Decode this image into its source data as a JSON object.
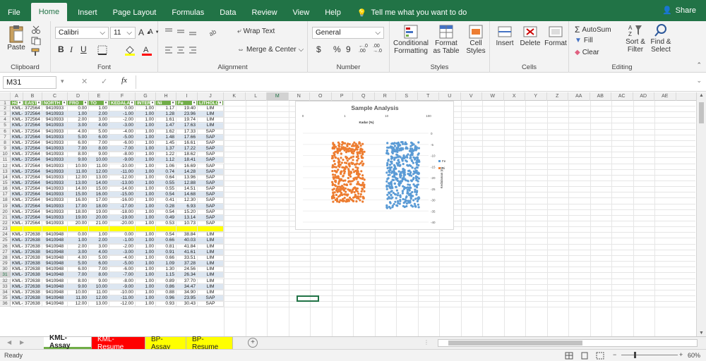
{
  "ribbon_tabs": [
    "File",
    "Home",
    "Insert",
    "Page Layout",
    "Formulas",
    "Data",
    "Review",
    "View",
    "Help"
  ],
  "active_tab": "Home",
  "tell_me": "Tell me what you want to do",
  "share": "Share",
  "ribbon": {
    "clipboard": {
      "label": "Clipboard",
      "paste": "Paste"
    },
    "font": {
      "label": "Font",
      "name": "Calibri",
      "size": "11"
    },
    "alignment": {
      "label": "Alignment",
      "wrap": "Wrap Text",
      "merge": "Merge & Center"
    },
    "number": {
      "label": "Number",
      "format": "General"
    },
    "styles": {
      "label": "Styles",
      "cond": "Conditional Formatting",
      "table": "Format as Table",
      "cell": "Cell Styles"
    },
    "cells": {
      "label": "Cells",
      "insert": "Insert",
      "delete": "Delete",
      "format": "Format"
    },
    "editing": {
      "label": "Editing",
      "autosum": "AutoSum",
      "fill": "Fill",
      "clear": "Clear",
      "sort": "Sort & Filter",
      "find": "Find & Select"
    }
  },
  "name_box": "M31",
  "columns": [
    "A",
    "B",
    "C",
    "D",
    "E",
    "F",
    "G",
    "H",
    "I",
    "J",
    "K",
    "L",
    "M",
    "N",
    "O",
    "P",
    "Q",
    "R",
    "S",
    "T",
    "U",
    "V",
    "W",
    "X",
    "Y",
    "Z",
    "AA",
    "AB",
    "AC",
    "AD",
    "AE"
  ],
  "headers": [
    "HOLE",
    "EASTI",
    "NORTH",
    "FRO",
    "TO",
    "KEDALAN",
    "INTER",
    "Ni",
    "Fe",
    "LITHOLO"
  ],
  "rows": [
    [
      "KML-14",
      "372564",
      "9410933",
      "0.00",
      "1.00",
      "0.00",
      "1.00",
      "1.17",
      "19.40",
      "LIM"
    ],
    [
      "KML-14",
      "372564",
      "9410933",
      "1.00",
      "2.00",
      "-1.00",
      "1.00",
      "1.28",
      "23.96",
      "LIM"
    ],
    [
      "KML-14",
      "372564",
      "9410933",
      "2.00",
      "3.00",
      "-2.00",
      "1.00",
      "1.61",
      "19.74",
      "LIM"
    ],
    [
      "KML-14",
      "372564",
      "9410933",
      "3.00",
      "4.00",
      "-3.00",
      "1.00",
      "1.47",
      "17.63",
      "LIM"
    ],
    [
      "KML-14",
      "372564",
      "9410933",
      "4.00",
      "5.00",
      "-4.00",
      "1.00",
      "1.62",
      "17.33",
      "SAP"
    ],
    [
      "KML-14",
      "372564",
      "9410933",
      "5.00",
      "6.00",
      "-5.00",
      "1.00",
      "1.48",
      "17.66",
      "SAP"
    ],
    [
      "KML-14",
      "372564",
      "9410933",
      "6.00",
      "7.00",
      "-6.00",
      "1.00",
      "1.45",
      "16.61",
      "SAP"
    ],
    [
      "KML-14",
      "372564",
      "9410933",
      "7.00",
      "8.00",
      "-7.00",
      "1.00",
      "1.37",
      "17.22",
      "SAP"
    ],
    [
      "KML-14",
      "372564",
      "9410933",
      "8.00",
      "9.00",
      "-8.00",
      "1.00",
      "1.22",
      "18.62",
      "SAP"
    ],
    [
      "KML-14",
      "372564",
      "9410933",
      "9.00",
      "10.00",
      "-9.00",
      "1.00",
      "1.12",
      "18.41",
      "SAP"
    ],
    [
      "KML-14",
      "372564",
      "9410933",
      "10.00",
      "11.00",
      "-10.00",
      "1.00",
      "1.06",
      "16.69",
      "SAP"
    ],
    [
      "KML-14",
      "372564",
      "9410933",
      "11.00",
      "12.00",
      "-11.00",
      "1.00",
      "0.74",
      "14.28",
      "SAP"
    ],
    [
      "KML-14",
      "372564",
      "9410933",
      "12.00",
      "13.00",
      "-12.00",
      "1.00",
      "0.64",
      "13.96",
      "SAP"
    ],
    [
      "KML-14",
      "372564",
      "9410933",
      "13.00",
      "14.00",
      "-13.00",
      "1.00",
      "0.55",
      "12.88",
      "SAP"
    ],
    [
      "KML-14",
      "372564",
      "9410933",
      "14.00",
      "15.00",
      "-14.00",
      "1.00",
      "0.55",
      "14.51",
      "SAP"
    ],
    [
      "KML-14",
      "372564",
      "9410933",
      "15.00",
      "16.00",
      "-15.00",
      "1.00",
      "0.54",
      "14.68",
      "SAP"
    ],
    [
      "KML-14",
      "372564",
      "9410933",
      "16.00",
      "17.00",
      "-16.00",
      "1.00",
      "0.41",
      "12.30",
      "SAP"
    ],
    [
      "KML-14",
      "372564",
      "9410933",
      "17.00",
      "18.00",
      "-17.00",
      "1.00",
      "0.28",
      "6.93",
      "SAP"
    ],
    [
      "KML-14",
      "372564",
      "9410933",
      "18.00",
      "19.00",
      "-18.00",
      "1.00",
      "0.54",
      "15.20",
      "SAP"
    ],
    [
      "KML-14",
      "372564",
      "9410933",
      "19.00",
      "20.00",
      "-19.00",
      "1.00",
      "0.49",
      "13.14",
      "SAP"
    ],
    [
      "KML-14",
      "372564",
      "9410933",
      "20.00",
      "21.00",
      "-20.00",
      "1.00",
      "0.53",
      "10.73",
      "SAP"
    ],
    [
      "",
      "",
      "",
      "",
      "",
      "",
      "",
      "",
      "",
      ""
    ],
    [
      "KML-15",
      "372638",
      "9410948",
      "0.00",
      "1.00",
      "0.00",
      "1.00",
      "0.54",
      "38.84",
      "LIM"
    ],
    [
      "KML-15",
      "372638",
      "9410948",
      "1.00",
      "2.00",
      "-1.00",
      "1.00",
      "0.66",
      "40.03",
      "LIM"
    ],
    [
      "KML-15",
      "372638",
      "9410948",
      "2.00",
      "3.00",
      "-2.00",
      "1.00",
      "0.81",
      "41.84",
      "LIM"
    ],
    [
      "KML-15",
      "372638",
      "9410948",
      "3.00",
      "4.00",
      "-3.00",
      "1.00",
      "0.91",
      "41.61",
      "LIM"
    ],
    [
      "KML-15",
      "372638",
      "9410948",
      "4.00",
      "5.00",
      "-4.00",
      "1.00",
      "0.66",
      "33.51",
      "LIM"
    ],
    [
      "KML-15",
      "372638",
      "9410948",
      "5.00",
      "6.00",
      "-5.00",
      "1.00",
      "1.09",
      "37.28",
      "LIM"
    ],
    [
      "KML-15",
      "372638",
      "9410948",
      "6.00",
      "7.00",
      "-6.00",
      "1.00",
      "1.30",
      "24.56",
      "LIM"
    ],
    [
      "KML-15",
      "372638",
      "9410948",
      "7.00",
      "8.00",
      "-7.00",
      "1.00",
      "1.15",
      "26.34",
      "LIM"
    ],
    [
      "KML-15",
      "372638",
      "9410948",
      "8.00",
      "9.00",
      "-8.00",
      "1.00",
      "0.89",
      "37.70",
      "LIM"
    ],
    [
      "KML-15",
      "372638",
      "9410948",
      "9.00",
      "10.00",
      "-9.00",
      "1.00",
      "0.86",
      "34.47",
      "LIM"
    ],
    [
      "KML-15",
      "372638",
      "9410948",
      "10.00",
      "11.00",
      "-10.00",
      "1.00",
      "0.88",
      "34.90",
      "LIM"
    ],
    [
      "KML-15",
      "372638",
      "9410948",
      "11.00",
      "12.00",
      "-11.00",
      "1.00",
      "0.96",
      "23.95",
      "SAP"
    ],
    [
      "KML-15",
      "372638",
      "9410948",
      "12.00",
      "13.00",
      "-12.00",
      "1.00",
      "0.93",
      "30.43",
      "SAP"
    ]
  ],
  "sheet_tabs": [
    {
      "name": "KML-Assay",
      "color": "#70ad47"
    },
    {
      "name": "KML-Resume",
      "color": "#ff0000"
    },
    {
      "name": "BP-Assay",
      "color": "#ffff00"
    },
    {
      "name": "BP-Resume",
      "color": "#ffff00"
    }
  ],
  "status": {
    "ready": "Ready",
    "zoom": "60%"
  },
  "chart_data": {
    "type": "scatter",
    "title": "Sample Analysis",
    "xlabel": "Kadar (%)",
    "ylabel": "Kedalaman (m)",
    "x_scale": "log",
    "x_ticks": [
      "0",
      "1",
      "10",
      "100"
    ],
    "y_ticks": [
      "0",
      "-5",
      "-10",
      "-15",
      "-20",
      "-25",
      "-30",
      "-35",
      "-40"
    ],
    "xlim": [
      0.1,
      100
    ],
    "ylim": [
      -40,
      0
    ],
    "legend_position": "right",
    "series": [
      {
        "name": "Fe",
        "color": "#5b9bd5",
        "x_range": [
          10,
          60
        ],
        "y_range": [
          -34,
          -4
        ]
      },
      {
        "name": "Ni",
        "color": "#ed7d31",
        "x_range": [
          0.5,
          3
        ],
        "y_range": [
          -31,
          -4
        ]
      }
    ]
  }
}
